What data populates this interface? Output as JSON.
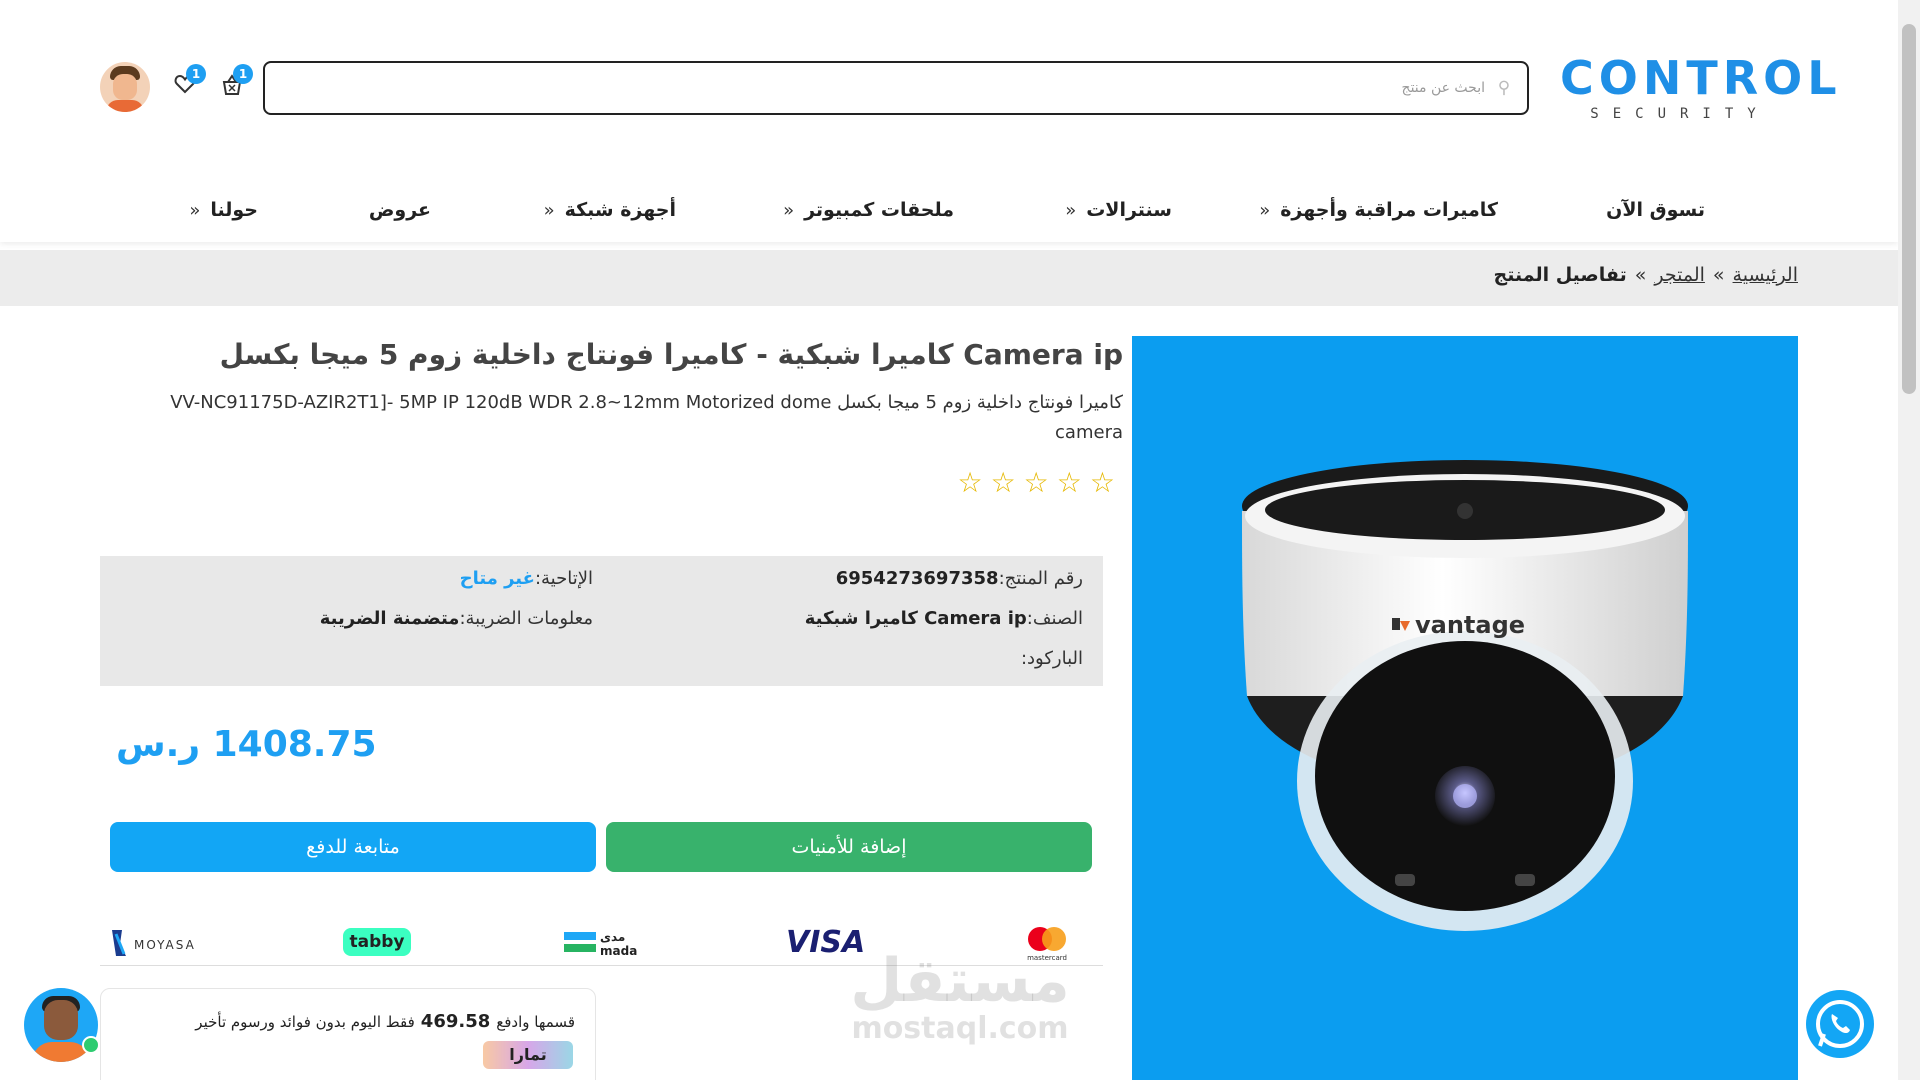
{
  "logo": {
    "main": "CONTROL",
    "sub": "SECURITY"
  },
  "search": {
    "placeholder": "ابحث عن منتج"
  },
  "header": {
    "cart_count": "1",
    "wishlist_count": "1"
  },
  "nav": [
    {
      "label": "تسوق الآن"
    },
    {
      "label": "كاميرات مراقبة وأجهزة"
    },
    {
      "label": "سنترالات"
    },
    {
      "label": "ملحقات كمبيوتر"
    },
    {
      "label": "أجهزة شبكة"
    },
    {
      "label": "عروض"
    },
    {
      "label": "حولنا"
    }
  ],
  "breadcrumb": {
    "home": "الرئيسية",
    "store": "المتجر",
    "current": "تفاصيل المنتج",
    "sep": "»"
  },
  "product": {
    "image_brand": "vantage",
    "title": "Camera ip كاميرا شبكية  -  كاميرا فونتاج داخلية زوم 5 ميجا بكسل",
    "description": "كاميرا فونتاج داخلية زوم 5 ميجا بكسل VV-NC91175D-AZIR2T1]- 5MP IP 120dB WDR 2.8~12mm Motorized dome camera",
    "rating_stars": 5,
    "rating_value": 0,
    "sku_label": "رقم المنتج:",
    "sku_value": "6954273697358",
    "availability_label": "الإتاحية:",
    "availability_value": "غير متاح",
    "category_label": "الصنف:",
    "category_value": "Camera ip كاميرا شبكية",
    "tax_label": "معلومات الضريبة:",
    "tax_value": "متضمنة الضريبة",
    "barcode_label": "الباركود:",
    "price": "1408.75 ر.س"
  },
  "buttons": {
    "wishlist": "إضافة للأمنيات",
    "checkout": "متابعة للدفع"
  },
  "payments": {
    "mastercard": "mastercard",
    "visa": "VISA",
    "mada_ar": "مدى",
    "mada_en": "mada",
    "tabby": "tabby",
    "moyasar": "MOYASA"
  },
  "tamara": {
    "text_before": "قسمها وادفع",
    "amount": "469.58",
    "text_after": "فقط اليوم بدون فوائد ورسوم تأخير",
    "logo": "تمارا"
  },
  "watermark": {
    "ar": "مستقل",
    "en": "mostaql.com"
  },
  "colors": {
    "accent": "#1e9ff2",
    "wishlist_btn": "#38b26c",
    "checkout_btn": "#12a6f5",
    "image_bg": "#0b9df0",
    "star": "#e6b800"
  }
}
